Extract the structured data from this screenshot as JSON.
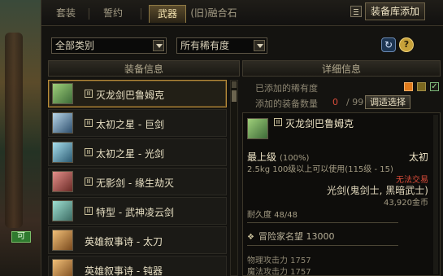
{
  "tabs": [
    "套装",
    "誓约",
    "武器",
    "(旧)融合石"
  ],
  "header": {
    "add_button": "装备库添加"
  },
  "filters": {
    "category": "全部类别",
    "rarity": "所有稀有度"
  },
  "left_panel": {
    "title": "装备信息",
    "items": [
      {
        "name": "灭龙剑巴鲁姆克",
        "tag": "Ⅲ",
        "selected": true,
        "thumb_color": "#3d6b38"
      },
      {
        "name": "太初之星 - 巨剑",
        "tag": "Ⅲ",
        "selected": false,
        "thumb_color": "#2e4f6e"
      },
      {
        "name": "太初之星 - 光剑",
        "tag": "Ⅲ",
        "selected": false,
        "thumb_color": "#2c5a72"
      },
      {
        "name": "无影剑 - 缘生劫灭",
        "tag": "Ⅲ",
        "selected": false,
        "thumb_color": "#6a2a26"
      },
      {
        "name": "特型 - 武神凌云剑",
        "tag": "Ⅲ",
        "selected": false,
        "thumb_color": "#3c6b63"
      },
      {
        "name": "英雄叙事诗 - 太刀",
        "tag": "",
        "selected": false,
        "thumb_color": "#7a4a1e"
      },
      {
        "name": "英雄叙事诗 - 钝器",
        "tag": "",
        "selected": false,
        "thumb_color": "#7a4a1e"
      }
    ]
  },
  "right_panel": {
    "title": "详细信息",
    "rarity_label": "已添加的稀有度",
    "count_label": "添加的装备数量",
    "count_value": "0",
    "count_max": "/ 99",
    "adjust_button": "调适选择",
    "detail": {
      "name": "灭龙剑巴鲁姆克",
      "tag": "Ⅲ",
      "grade": "最上级",
      "grade_pct": "(100%)",
      "set": "太初",
      "weight_level": "2.5kg  100级以上可以使用(115级 - 15)",
      "trade": "无法交易",
      "type": "光剑(鬼剑士, 黑暗武士)",
      "price": "43,920金币",
      "durability": "耐久度 48/48",
      "fame": "冒险家名望 13000",
      "phys_atk": "物理攻击力 1757",
      "mag_atk": "魔法攻击力 1757"
    }
  },
  "side": {
    "badge": "可"
  },
  "colors": {
    "accent": "#b98d3a",
    "danger": "#d94c3a",
    "rarity_orange": "#e07a1c"
  }
}
